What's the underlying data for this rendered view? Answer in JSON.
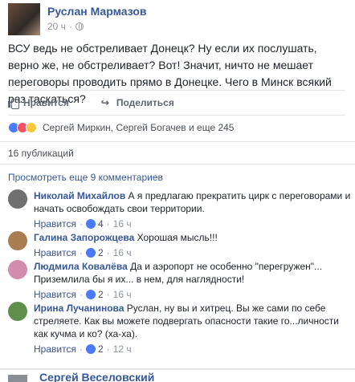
{
  "post": {
    "author": "Руслан Мармазов",
    "time": "20 ч",
    "text": "ВСУ ведь не обстреливает Донецк? Ну если их послушать, верно же, не обстреливает? Вот! Значит, ничто не мешает переговоры проводить прямо в Донецке. Чего в Минск всякий раз таскаться?"
  },
  "actions": {
    "like": "Нравится",
    "share": "Поделиться"
  },
  "reactions": {
    "names": "Сергей Миркин, Сергей Богачев и еще 245",
    "icons": [
      "like-icon",
      "love-icon",
      "haha-icon"
    ]
  },
  "shares": "16 публикаций",
  "more_comments": "Просмотреть еще 9 комментариев",
  "comments": [
    {
      "name": "Николай Михайлов",
      "text": "А я предлагаю прекратить цирк с переговорами и начать освобождать свои территории.",
      "like": "Нравится",
      "likes": "4",
      "time": "16 ч"
    },
    {
      "name": "Галина Запорожцева",
      "text": "Хорошая мысль!!!",
      "like": "Нравится",
      "likes": "2",
      "time": "16 ч"
    },
    {
      "name": "Людмила Ковалёва",
      "text": "Да и аэропорт не особенно \"перегружен\"... Приземлила бы я их... в нем, для наглядности!",
      "like": "Нравится",
      "likes": "2",
      "time": "16 ч"
    },
    {
      "name": "Ирина Лучанинова",
      "text": "Руслан, ну вы и хитрец. Вы же сами по себе стреляете. Как вы можете подвергать опасности такие го...личности как кучма и ко? (ха-ха).",
      "like": "Нравится",
      "likes": "2",
      "time": "12 ч"
    }
  ],
  "next_post": {
    "author": "Сергей Веселовский"
  },
  "colors": {
    "link": "#365899",
    "muted": "#90949c",
    "like_blue": "#4a7aff"
  }
}
